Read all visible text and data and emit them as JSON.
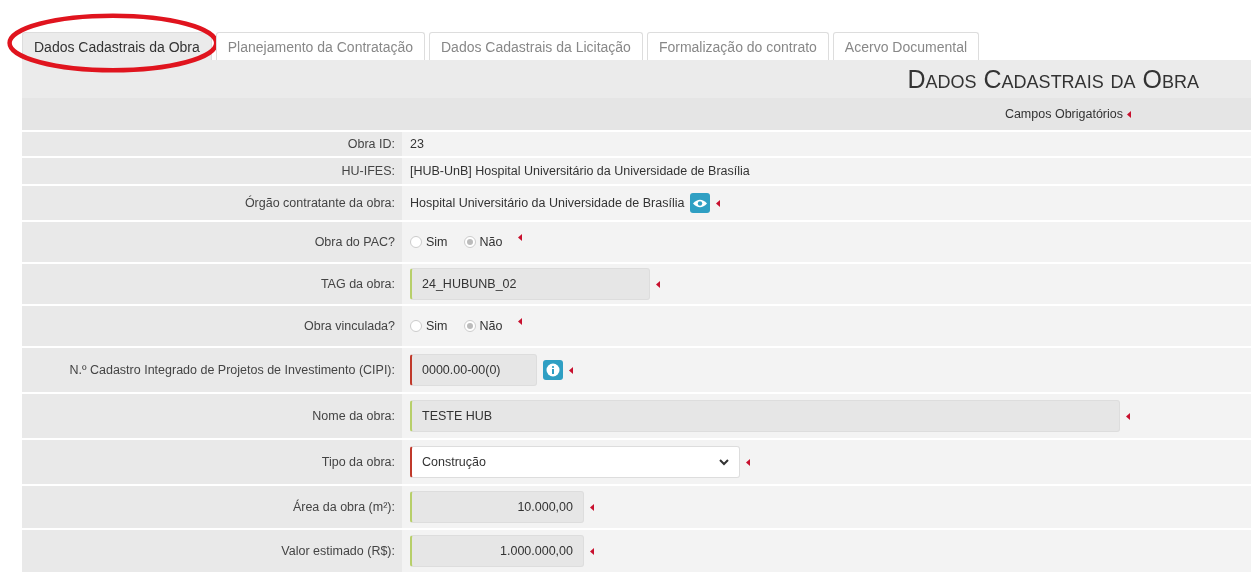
{
  "tabs": [
    {
      "label": "Dados Cadastrais da Obra",
      "selected": true,
      "annotated": true
    },
    {
      "label": "Planejamento da Contratação",
      "selected": false,
      "annotated": false
    },
    {
      "label": "Dados Cadastrais da Licitação",
      "selected": false,
      "annotated": false
    },
    {
      "label": "Formalização do contrato",
      "selected": false,
      "annotated": false
    },
    {
      "label": "Acervo Documental",
      "selected": false,
      "annotated": false
    }
  ],
  "section_title": "Dados Cadastrais da Obra",
  "required_legend": "Campos Obrigatórios",
  "rows": [
    {
      "label": "Obra ID:",
      "kind": "text",
      "value": "23",
      "required": false
    },
    {
      "label": "HU-IFES:",
      "kind": "text",
      "value": "[HUB-UnB] Hospital Universitário da Universidade de Brasília",
      "required": false
    },
    {
      "label": "Órgão contratante da obra:",
      "kind": "text_view",
      "value": "Hospital Universitário da Universidade de Brasília",
      "required": true
    },
    {
      "label": "Obra do PAC?",
      "kind": "radio",
      "options": [
        {
          "label": "Sim",
          "selected": false
        },
        {
          "label": "Não",
          "selected": true
        }
      ],
      "required": true
    },
    {
      "label": "TAG da obra:",
      "kind": "input",
      "value": "24_HUBUNB_02",
      "valid": true,
      "required": true
    },
    {
      "label": "Obra vinculada?",
      "kind": "radio",
      "options": [
        {
          "label": "Sim",
          "selected": false
        },
        {
          "label": "Não",
          "selected": true
        }
      ],
      "required": true
    },
    {
      "label": "N.º Cadastro Integrado de Projetos de Investimento (CIPI):",
      "kind": "input_info",
      "value": "0000.00-00(0)",
      "valid": false,
      "required": true
    },
    {
      "label": "Nome da obra:",
      "kind": "input",
      "value": "TESTE HUB",
      "valid": true,
      "required": true
    },
    {
      "label": "Tipo da obra:",
      "kind": "select",
      "value": "Construção",
      "valid": false,
      "required": true
    },
    {
      "label": "Área da obra (m²):",
      "kind": "number",
      "value": "10.000,00",
      "valid": true,
      "required": true
    },
    {
      "label": "Valor estimado (R$):",
      "kind": "number",
      "value": "1.000.000,00",
      "valid": true,
      "required": true
    }
  ]
}
